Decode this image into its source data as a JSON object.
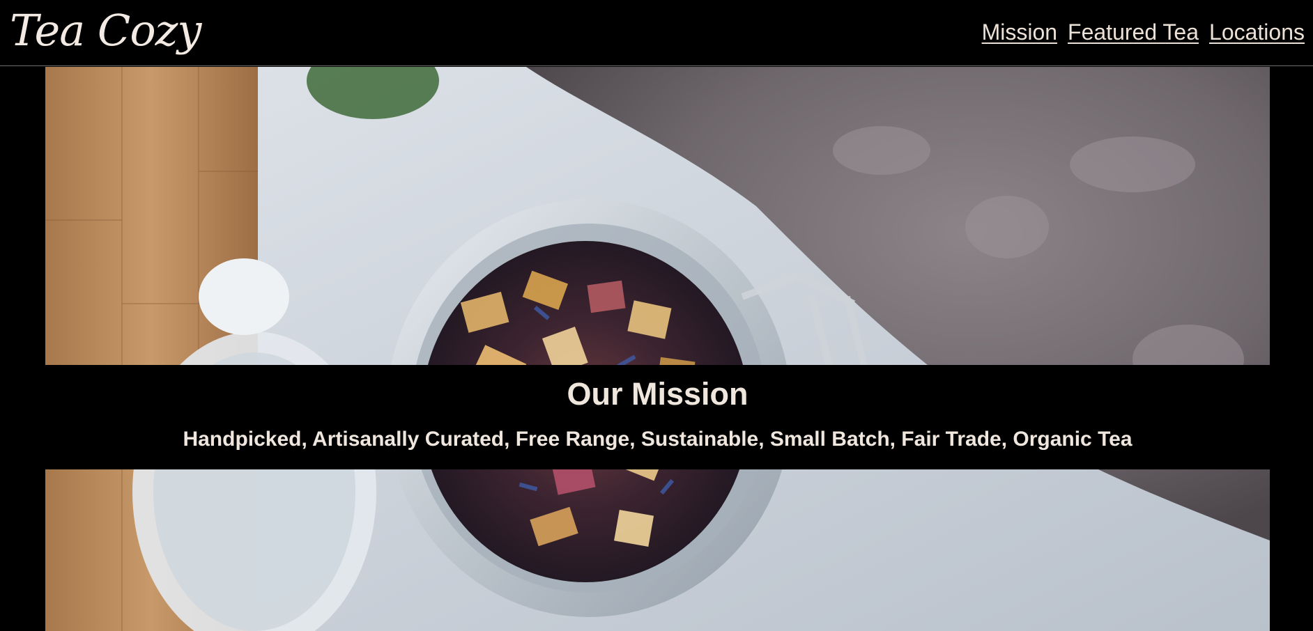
{
  "header": {
    "logo_text": "Tea Cozy",
    "nav": [
      {
        "label": "Mission"
      },
      {
        "label": "Featured Tea"
      },
      {
        "label": "Locations"
      }
    ]
  },
  "hero": {
    "image_subject": "jar of loose-leaf herbal tea on a table"
  },
  "mission": {
    "title": "Our Mission",
    "statement": "Handpicked, Artisanally Curated, Free Range, Sustainable, Small Batch, Fair Trade, Organic Tea"
  },
  "colors": {
    "background": "#000000",
    "text": "#efe6dd",
    "header_border": "#6e6e6e"
  }
}
